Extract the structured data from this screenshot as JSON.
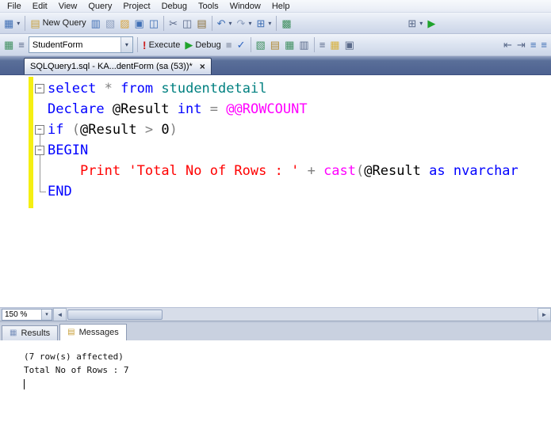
{
  "icons": {
    "dropdown": "▾",
    "scroll_left": "◄",
    "scroll_right": "►"
  },
  "menu_bar": {
    "items": [
      "File",
      "Edit",
      "View",
      "Query",
      "Project",
      "Debug",
      "Tools",
      "Window",
      "Help"
    ]
  },
  "toolbar_standard": {
    "items": [
      {
        "type": "icon",
        "name": "new-connection-icon",
        "glyph": "▦",
        "color": "#3f6fb5",
        "dropdown": true
      },
      {
        "type": "sep"
      },
      {
        "type": "button",
        "name": "new-query-button",
        "glyph": "▤",
        "color": "#caa23c",
        "label": "New Query"
      },
      {
        "type": "icon",
        "name": "database-engine-query-icon",
        "glyph": "▥",
        "color": "#3f6fb5"
      },
      {
        "type": "icon",
        "name": "analysis-query-icon",
        "glyph": "▧",
        "color": "#8fa0bf"
      },
      {
        "type": "icon",
        "name": "open-file-icon",
        "glyph": "▨",
        "color": "#d9a43b"
      },
      {
        "type": "icon",
        "name": "save-icon",
        "glyph": "▣",
        "color": "#3f6fb5"
      },
      {
        "type": "icon",
        "name": "save-all-icon",
        "glyph": "◫",
        "color": "#3f6fb5"
      },
      {
        "type": "sep"
      },
      {
        "type": "icon",
        "name": "cut-icon",
        "glyph": "✂",
        "color": "#5a6a8a"
      },
      {
        "type": "icon",
        "name": "copy-icon",
        "glyph": "◫",
        "color": "#5a6a8a"
      },
      {
        "type": "icon",
        "name": "paste-icon",
        "glyph": "▤",
        "color": "#8a6f3a"
      },
      {
        "type": "sep"
      },
      {
        "type": "icon",
        "name": "undo-icon",
        "glyph": "↶",
        "color": "#3f6fb5",
        "dropdown": true
      },
      {
        "type": "icon",
        "name": "redo-icon",
        "glyph": "↷",
        "color": "#8fa0bf",
        "dropdown": true
      },
      {
        "type": "icon",
        "name": "navigate-icon",
        "glyph": "⊞",
        "color": "#3f6fb5",
        "dropdown": true
      },
      {
        "type": "sep"
      },
      {
        "type": "icon",
        "name": "activity-monitor-icon",
        "glyph": "▩",
        "color": "#3f8f5f"
      },
      {
        "type": "spacer"
      },
      {
        "type": "icon",
        "name": "grid-dropdown-icon",
        "glyph": "⊞",
        "color": "#5a6a8a",
        "dropdown": true
      },
      {
        "type": "icon",
        "name": "play-icon",
        "glyph": "▶",
        "color": "#1fa32c"
      },
      {
        "type": "spacer"
      }
    ]
  },
  "toolbar_query": {
    "items": [
      {
        "type": "icon",
        "name": "available-databases-icon",
        "glyph": "▦",
        "color": "#3f8f5f"
      },
      {
        "type": "icon",
        "name": "sqlcmd-mode-icon",
        "glyph": "≡",
        "color": "#5a6a8a"
      },
      {
        "type": "combo",
        "name": "database-combobox",
        "value": "StudentForm"
      },
      {
        "type": "sep"
      },
      {
        "type": "button",
        "name": "execute-button",
        "glyph": "!",
        "color": "#cc2222",
        "label": "Execute",
        "exec": true
      },
      {
        "type": "button",
        "name": "debug-button",
        "glyph": "▶",
        "color": "#1fa32c",
        "label": "Debug"
      },
      {
        "type": "icon",
        "name": "stop-icon",
        "glyph": "■",
        "color": "#8fa0bf",
        "disabled": true
      },
      {
        "type": "icon",
        "name": "parse-icon",
        "glyph": "✓",
        "color": "#2a62c0"
      },
      {
        "type": "sep"
      },
      {
        "type": "icon",
        "name": "estimated-plan-icon",
        "glyph": "▧",
        "color": "#3f8f5f"
      },
      {
        "type": "icon",
        "name": "query-options-icon",
        "glyph": "▤",
        "color": "#b08830"
      },
      {
        "type": "icon",
        "name": "intellisense-icon",
        "glyph": "▦",
        "color": "#3f8f5f"
      },
      {
        "type": "icon",
        "name": "actual-plan-icon",
        "glyph": "▥",
        "color": "#5a6a8a"
      },
      {
        "type": "sep"
      },
      {
        "type": "icon",
        "name": "results-to-text-icon",
        "glyph": "≡",
        "color": "#5a6a8a"
      },
      {
        "type": "icon",
        "name": "results-to-grid-icon",
        "glyph": "▦",
        "color": "#d8b13c"
      },
      {
        "type": "icon",
        "name": "results-to-file-icon",
        "glyph": "▣",
        "color": "#5a6a8a"
      },
      {
        "type": "spacer"
      },
      {
        "type": "icon",
        "name": "indent-decrease-icon",
        "glyph": "⇤",
        "color": "#5a6a8a"
      },
      {
        "type": "icon",
        "name": "indent-increase-icon",
        "glyph": "⇥",
        "color": "#5a6a8a"
      },
      {
        "type": "icon",
        "name": "comment-icon",
        "glyph": "≡",
        "color": "#3f6fb5"
      },
      {
        "type": "icon",
        "name": "uncomment-icon",
        "glyph": "≡",
        "color": "#3f6fb5"
      }
    ]
  },
  "document_tab": {
    "title": "SQLQuery1.sql - KA...dentForm (sa (53))*",
    "close_glyph": "×"
  },
  "editor": {
    "zoom_value": "150 %",
    "fold_glyph": "−",
    "change_bar_color": "#f5ef13",
    "token_colors": {
      "kw": "#0000ff",
      "id": "#000000",
      "op": "#808080",
      "str": "#ff0000",
      "sys": "#ff00ff",
      "tbl": "#008080"
    },
    "code_lines": [
      {
        "fold": true,
        "tokens": [
          {
            "t": "select",
            "c": "kw"
          },
          {
            "t": " ",
            "c": "id"
          },
          {
            "t": "*",
            "c": "op"
          },
          {
            "t": " ",
            "c": "id"
          },
          {
            "t": "from",
            "c": "kw"
          },
          {
            "t": " ",
            "c": "id"
          },
          {
            "t": "studentdetail",
            "c": "tbl"
          }
        ]
      },
      {
        "fold": false,
        "tokens": [
          {
            "t": "Declare",
            "c": "kw"
          },
          {
            "t": " @Result ",
            "c": "id"
          },
          {
            "t": "int",
            "c": "kw"
          },
          {
            "t": " ",
            "c": "id"
          },
          {
            "t": "=",
            "c": "op"
          },
          {
            "t": " ",
            "c": "id"
          },
          {
            "t": "@@ROWCOUNT",
            "c": "sys"
          }
        ]
      },
      {
        "fold": true,
        "tokens": [
          {
            "t": "if",
            "c": "kw"
          },
          {
            "t": " ",
            "c": "id"
          },
          {
            "t": "(",
            "c": "op"
          },
          {
            "t": "@Result ",
            "c": "id"
          },
          {
            "t": ">",
            "c": "op"
          },
          {
            "t": " 0",
            "c": "id"
          },
          {
            "t": ")",
            "c": "op"
          }
        ]
      },
      {
        "fold": true,
        "tokens": [
          {
            "t": "BEGIN",
            "c": "kw"
          }
        ]
      },
      {
        "fold": false,
        "tokens": [
          {
            "t": "    ",
            "c": "id"
          },
          {
            "t": "Print ",
            "c": "str"
          },
          {
            "t": "'Total No of Rows : '",
            "c": "str"
          },
          {
            "t": " ",
            "c": "id"
          },
          {
            "t": "+",
            "c": "op"
          },
          {
            "t": " ",
            "c": "id"
          },
          {
            "t": "cast",
            "c": "sys"
          },
          {
            "t": "(",
            "c": "op"
          },
          {
            "t": "@Result ",
            "c": "id"
          },
          {
            "t": "as",
            "c": "kw"
          },
          {
            "t": " ",
            "c": "id"
          },
          {
            "t": "nvarchar",
            "c": "kw"
          }
        ]
      },
      {
        "fold": false,
        "tokens": [
          {
            "t": "END",
            "c": "kw"
          }
        ]
      }
    ]
  },
  "results_pane": {
    "tabs": [
      {
        "label": "Results",
        "icon": "▦"
      },
      {
        "label": "Messages",
        "icon": "▤"
      }
    ],
    "messages": [
      "(7 row(s) affected)",
      "Total No of Rows : 7"
    ]
  }
}
